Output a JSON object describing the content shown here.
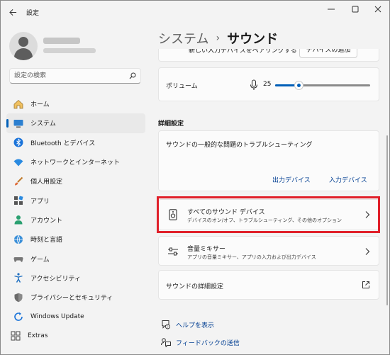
{
  "window": {
    "title": "設定",
    "controls": [
      "minimize",
      "maximize",
      "close"
    ]
  },
  "sidebar": {
    "search_placeholder": "設定の検索",
    "items": [
      {
        "label": "ホーム",
        "icon": "home-icon"
      },
      {
        "label": "システム",
        "icon": "system-icon",
        "selected": true
      },
      {
        "label": "Bluetooth とデバイス",
        "icon": "bluetooth-icon"
      },
      {
        "label": "ネットワークとインターネット",
        "icon": "network-icon"
      },
      {
        "label": "個人用設定",
        "icon": "brush-icon"
      },
      {
        "label": "アプリ",
        "icon": "apps-icon"
      },
      {
        "label": "アカウント",
        "icon": "account-icon"
      },
      {
        "label": "時刻と言語",
        "icon": "time-language-icon"
      },
      {
        "label": "ゲーム",
        "icon": "gaming-icon"
      },
      {
        "label": "アクセシビリティ",
        "icon": "accessibility-icon"
      },
      {
        "label": "プライバシーとセキュリティ",
        "icon": "shield-icon"
      },
      {
        "label": "Windows Update",
        "icon": "windows-update-icon"
      },
      {
        "label": "Extras",
        "icon": "extras-icon"
      }
    ]
  },
  "main": {
    "breadcrumb": {
      "parent": "システム",
      "current": "サウンド"
    },
    "partial_row": {
      "text": "新しい入力デバイスをペアリングする",
      "button": "デバイスの追加"
    },
    "volume": {
      "label": "ボリューム",
      "value": "25",
      "level_percent": 25
    },
    "section_title": "詳細設定",
    "troubleshoot": {
      "title": "サウンドの一般的な問題のトラブルシューティング",
      "output_link": "出力デバイス",
      "input_link": "入力デバイス"
    },
    "all_devices": {
      "title": "すべてのサウンド デバイス",
      "subtitle": "デバイスのオン/オフ、トラブルシューティング、その他のオプション"
    },
    "mixer": {
      "title": "音量ミキサー",
      "subtitle": "アプリの音量ミキサー、アプリの入力および出力デバイス"
    },
    "advanced": {
      "title": "サウンドの詳細設定"
    },
    "help": {
      "show_help": "ヘルプを表示",
      "feedback": "フィードバックの送信"
    }
  },
  "colors": {
    "accent": "#005fb8",
    "highlight": "#e0202a",
    "link": "#003e92"
  }
}
